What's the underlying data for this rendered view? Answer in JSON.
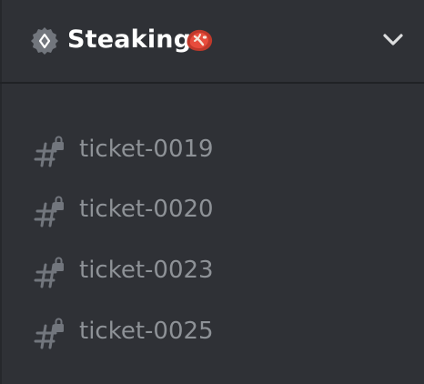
{
  "server": {
    "name": "Steaking",
    "badge_icon": "verified-shield-icon",
    "emoji_icon": "steak-emoji-icon",
    "dropdown_icon": "chevron-down-icon"
  },
  "channels": [
    {
      "name": "ticket-0019",
      "icon": "locked-hash-icon"
    },
    {
      "name": "ticket-0020",
      "icon": "locked-hash-icon"
    },
    {
      "name": "ticket-0023",
      "icon": "locked-hash-icon"
    },
    {
      "name": "ticket-0025",
      "icon": "locked-hash-icon"
    }
  ],
  "colors": {
    "background": "#2f3136",
    "divider": "#202225",
    "server_name": "#ffffff",
    "channel_text": "#8e9297",
    "icon_muted": "#72767d"
  }
}
